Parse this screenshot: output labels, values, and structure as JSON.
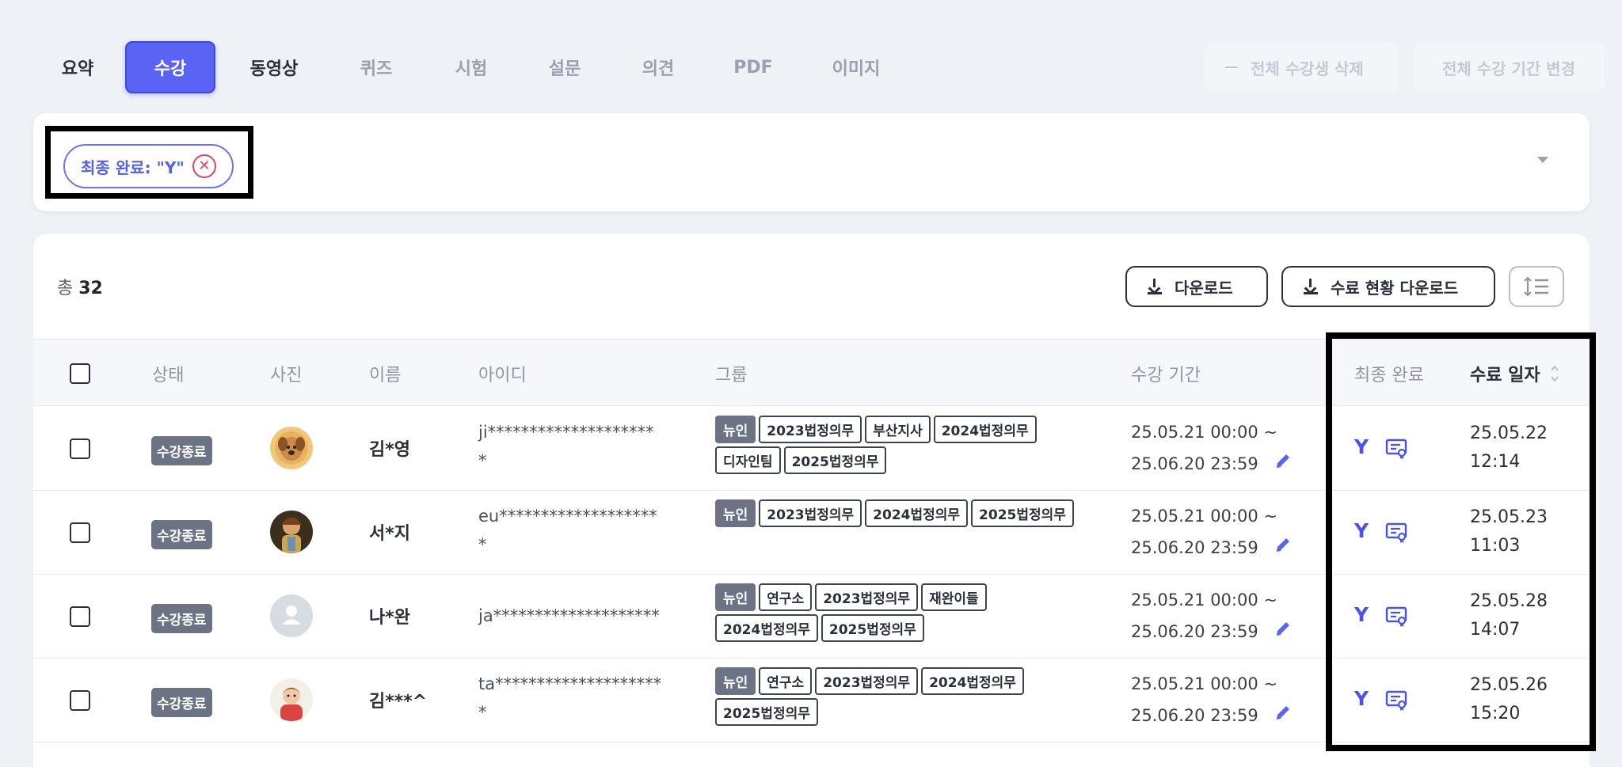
{
  "tabs": [
    {
      "label": "요약",
      "state": "strong"
    },
    {
      "label": "수강",
      "state": "active"
    },
    {
      "label": "동영상",
      "state": "strong"
    },
    {
      "label": "퀴즈",
      "state": "muted"
    },
    {
      "label": "시험",
      "state": "muted"
    },
    {
      "label": "설문",
      "state": "muted"
    },
    {
      "label": "의견",
      "state": "muted"
    },
    {
      "label": "PDF",
      "state": "muted"
    },
    {
      "label": "이미지",
      "state": "muted"
    }
  ],
  "top_actions": {
    "delete_all": "전체 수강생 삭제",
    "change_period": "전체 수강 기간 변경"
  },
  "filter": {
    "chip_label": "최종 완료: \"Y\""
  },
  "summary": {
    "total_label": "총",
    "total_count": "32"
  },
  "toolbar": {
    "download": "다운로드",
    "completion_download": "수료 현황 다운로드"
  },
  "columns": {
    "status": "상태",
    "photo": "사진",
    "name": "이름",
    "id": "아이디",
    "group": "그룹",
    "period": "수강 기간",
    "final_complete": "최종 완료",
    "completed_at": "수료 일자"
  },
  "rows": [
    {
      "status": "수강종료",
      "avatar": "dog",
      "name": "김*영",
      "id_line1": "ji********************",
      "id_line2": "*",
      "tags": [
        "뉴인",
        "2023법정의무",
        "부산지사",
        "2024법정의무",
        "디자인팀",
        "2025법정의무"
      ],
      "period_start": "25.05.21 00:00 ~",
      "period_end": "25.06.20 23:59",
      "final": "Y",
      "done_date": "25.05.22",
      "done_time": "12:14"
    },
    {
      "status": "수강종료",
      "avatar": "character",
      "name": "서*지",
      "id_line1": "eu*******************",
      "id_line2": "*",
      "tags": [
        "뉴인",
        "2023법정의무",
        "2024법정의무",
        "2025법정의무"
      ],
      "period_start": "25.05.21 00:00 ~",
      "period_end": "25.06.20 23:59",
      "final": "Y",
      "done_date": "25.05.23",
      "done_time": "11:03"
    },
    {
      "status": "수강종료",
      "avatar": "default",
      "name": "나*완",
      "id_line1": "ja********************",
      "id_line2": "",
      "tags": [
        "뉴인",
        "연구소",
        "2023법정의무",
        "재완이들",
        "2024법정의무",
        "2025법정의무"
      ],
      "period_start": "25.05.21 00:00 ~",
      "period_end": "25.06.20 23:59",
      "final": "Y",
      "done_date": "25.05.28",
      "done_time": "14:07"
    },
    {
      "status": "수강종료",
      "avatar": "child",
      "name": "김***^",
      "id_line1": "ta********************",
      "id_line2": "*",
      "tags": [
        "뉴인",
        "연구소",
        "2023법정의무",
        "2024법정의무",
        "2025법정의무"
      ],
      "period_start": "25.05.21 00:00 ~",
      "period_end": "25.06.20 23:59",
      "final": "Y",
      "done_date": "25.05.26",
      "done_time": "15:20"
    }
  ],
  "icons": {
    "chip_close": "close-circle-icon",
    "filter_expand": "caret-down-icon",
    "download": "download-icon",
    "sort": "sort-lines-icon",
    "edit_period": "pencil-icon",
    "certificate": "certificate-icon",
    "sort_column": "sort-arrows-icon"
  },
  "colors": {
    "accent": "#5b63f5",
    "status_badge": "#6b7385",
    "danger": "#e0445a",
    "page_bg": "#eef1f6"
  }
}
